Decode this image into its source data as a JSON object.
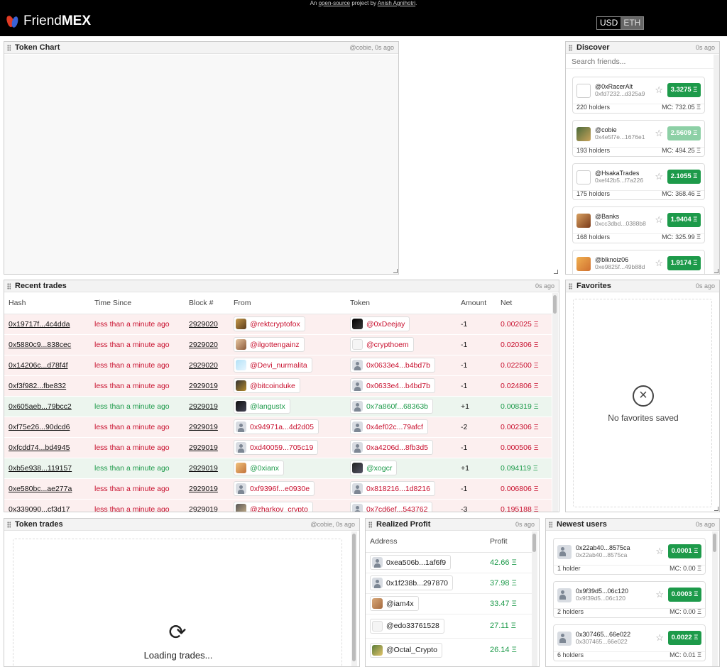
{
  "topbar": {
    "pre": "An",
    "link": "open-source",
    "mid": "project by",
    "author": "Anish Agnihotri",
    "post": "."
  },
  "header": {
    "brand_light": "Friend",
    "brand_bold": "MEX",
    "currency": [
      "USD",
      "ETH"
    ]
  },
  "token_chart": {
    "title": "Token Chart",
    "meta": "@cobie, 0s ago"
  },
  "discover": {
    "title": "Discover",
    "meta": "0s ago",
    "search_placeholder": "Search friends...",
    "cards": [
      {
        "name": "@0xRacerAlt",
        "addr": "0xfd7232...d325a9",
        "price": "3.3275 Ξ",
        "holders": "220 holders",
        "mc": "MC: 732.05 Ξ"
      },
      {
        "name": "@cobie",
        "addr": "0x4e5f7e...1676e1",
        "price": "2.5609 Ξ",
        "holders": "193 holders",
        "mc": "MC: 494.25 Ξ"
      },
      {
        "name": "@HsakaTrades",
        "addr": "0xef42b5...f7a226",
        "price": "2.1055 Ξ",
        "holders": "175 holders",
        "mc": "MC: 368.46 Ξ"
      },
      {
        "name": "@Banks",
        "addr": "0xcc3dbd...0388b8",
        "price": "1.9404 Ξ",
        "holders": "168 holders",
        "mc": "MC: 325.99 Ξ"
      },
      {
        "name": "@blknoiz06",
        "addr": "0xe9825f...49b88d",
        "price": "1.9174 Ξ",
        "holders": "",
        "mc": ""
      }
    ]
  },
  "recent_trades": {
    "title": "Recent trades",
    "meta": "0s ago",
    "columns": [
      "Hash",
      "Time Since",
      "Block #",
      "From",
      "Token",
      "Amount",
      "Net"
    ],
    "rows": [
      {
        "hash": "0x19717f...4c4dda",
        "time": "less than a minute ago",
        "block": "2929020",
        "from": "@rektcryptofox",
        "token": "@0xDeejay",
        "amount": "-1",
        "net": "0.002025 Ξ"
      },
      {
        "hash": "0x5880c9...838cec",
        "time": "less than a minute ago",
        "block": "2929020",
        "from": "@ilgottengainz",
        "token": "@crypthoem",
        "amount": "-1",
        "net": "0.020306 Ξ"
      },
      {
        "hash": "0x14206c...d78f4f",
        "time": "less than a minute ago",
        "block": "2929020",
        "from": "@Devi_nurmalita",
        "token": "0x0633e4...b4bd7b",
        "amount": "-1",
        "net": "0.022500 Ξ"
      },
      {
        "hash": "0xf3f982...fbe832",
        "time": "less than a minute ago",
        "block": "2929019",
        "from": "@bitcoinduke",
        "token": "0x0633e4...b4bd7b",
        "amount": "-1",
        "net": "0.024806 Ξ"
      },
      {
        "hash": "0x605aeb...79bcc2",
        "time": "less than a minute ago",
        "block": "2929019",
        "from": "@langustx",
        "token": "0x7a860f...68363b",
        "amount": "+1",
        "net": "0.008319 Ξ"
      },
      {
        "hash": "0xf75e26...90dcd6",
        "time": "less than a minute ago",
        "block": "2929019",
        "from": "0x94971a...4d2d05",
        "token": "0x4ef02c...79afcf",
        "amount": "-2",
        "net": "0.002306 Ξ"
      },
      {
        "hash": "0xfcdd74...bd4945",
        "time": "less than a minute ago",
        "block": "2929019",
        "from": "0xd40059...705c19",
        "token": "0xa4206d...8fb3d5",
        "amount": "-1",
        "net": "0.000506 Ξ"
      },
      {
        "hash": "0xb5e938...119157",
        "time": "less than a minute ago",
        "block": "2929019",
        "from": "@0xianx",
        "token": "@xogcr",
        "amount": "+1",
        "net": "0.094119 Ξ"
      },
      {
        "hash": "0xe580bc...ae277a",
        "time": "less than a minute ago",
        "block": "2929019",
        "from": "0xf9396f...e0930e",
        "token": "0x818216...1d8216",
        "amount": "-1",
        "net": "0.006806 Ξ"
      },
      {
        "hash": "0x339090...cf3d17",
        "time": "less than a minute ago",
        "block": "2929019",
        "from": "@zharkov_crypto",
        "token": "0x7cd6ef...543762",
        "amount": "-3",
        "net": "0.195188 Ξ"
      }
    ]
  },
  "favorites": {
    "title": "Favorites",
    "meta": "0s ago",
    "empty": "No favorites saved"
  },
  "token_trades": {
    "title": "Token trades",
    "meta": "@cobie, 0s ago",
    "loading": "Loading trades..."
  },
  "realized_profit": {
    "title": "Realized Profit",
    "meta": "0s ago",
    "columns": [
      "Address",
      "Profit"
    ],
    "rows": [
      {
        "addr": "0xea506b...1af6f9",
        "profit": "42.66 Ξ"
      },
      {
        "addr": "0x1f238b...297870",
        "profit": "37.98 Ξ"
      },
      {
        "addr": "@iam4x",
        "profit": "33.47 Ξ"
      },
      {
        "addr": "@edo33761528",
        "profit": "27.11 Ξ"
      },
      {
        "addr": "@Octal_Crypto",
        "profit": "26.14 Ξ"
      }
    ]
  },
  "newest_users": {
    "title": "Newest users",
    "meta": "0s ago",
    "cards": [
      {
        "name": "0x22ab40...8575ca",
        "addr": "0x22ab40...8575ca",
        "price": "0.0001 Ξ",
        "holders": "1 holder",
        "mc": "MC: 0.00 Ξ"
      },
      {
        "name": "0x9f39d5...06c120",
        "addr": "0x9f39d5...06c120",
        "price": "0.0003 Ξ",
        "holders": "2 holders",
        "mc": "MC: 0.00 Ξ"
      },
      {
        "name": "0x307465...66e022",
        "addr": "0x307465...66e022",
        "price": "0.0022 Ξ",
        "holders": "6 holders",
        "mc": "MC: 0.01 Ξ"
      }
    ]
  }
}
